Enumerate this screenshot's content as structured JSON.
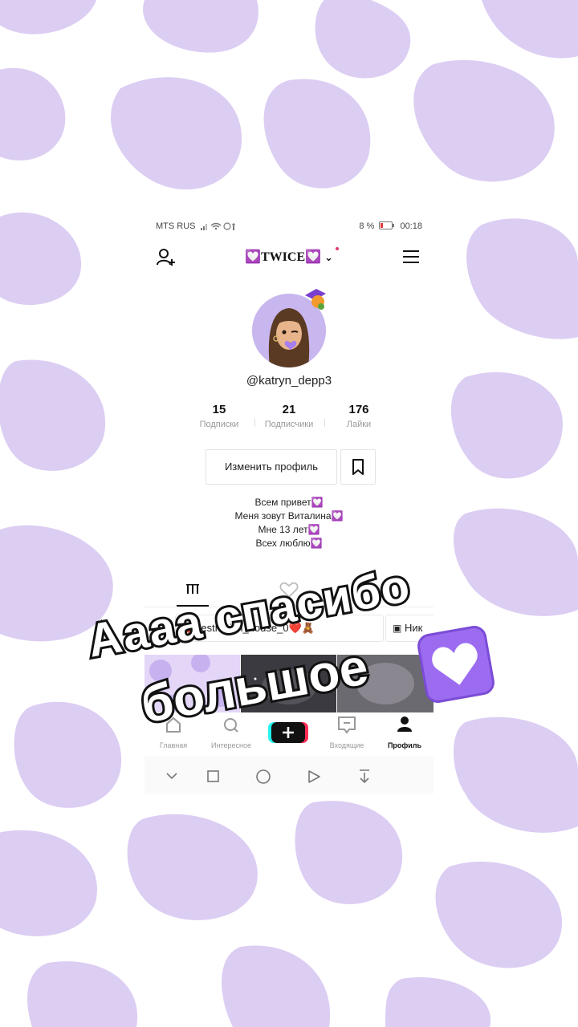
{
  "status_bar": {
    "carrier": "MTS RUS",
    "battery": "8 %",
    "time": "00:18"
  },
  "header": {
    "account_name": "💟TWICE💟"
  },
  "profile": {
    "username": "@katryn_depp3",
    "stats": [
      {
        "value": "15",
        "label": "Подписки"
      },
      {
        "value": "21",
        "label": "Подписчики"
      },
      {
        "value": "176",
        "label": "Лайки"
      }
    ],
    "edit_button": "Изменить профиль",
    "bio": [
      "Всем привет💟",
      "Меня зовут Виталина💟",
      "Мне 13 лет💟",
      "Всех люблю💟"
    ]
  },
  "chips": [
    {
      "label": "❤️aesthetich_house_0❤️🧸"
    },
    {
      "label": "Ник"
    }
  ],
  "bottom_nav": [
    {
      "label": "Главная"
    },
    {
      "label": "Интересное"
    },
    {
      "label": ""
    },
    {
      "label": "Входящие"
    },
    {
      "label": "Профиль"
    }
  ],
  "overlay": {
    "line1": "Аааа спасибо",
    "line2": "большое"
  },
  "colors": {
    "background_pattern": "#d9c9f2",
    "accent_purple": "#9b6cf0",
    "plus_cyan": "#25f4ee",
    "plus_pink": "#fe2c55"
  }
}
